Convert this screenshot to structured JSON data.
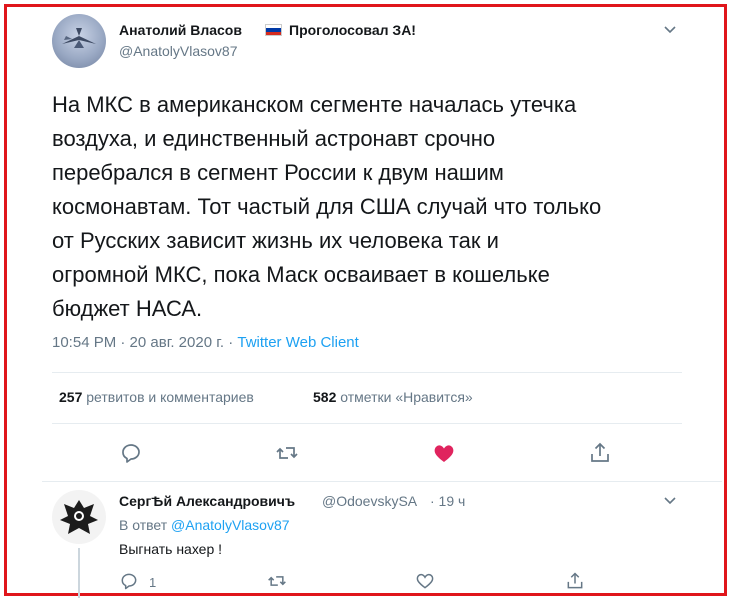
{
  "tweet": {
    "author_name": "Анатолий Власов",
    "voted_text": "Проголосовал ЗА!",
    "handle": "@AnatolyVlasov87",
    "text": "На МКС в американском сегменте началась утечка\nвоздуха, и единственный астронавт срочно\nперебрался в сегмент России к двум нашим\nкосмонавтам. Тот частый для США случай что только\nот Русских зависит жизнь их человека так и\nогромной МКС, пока Маск осваивает в кошельке\nбюджет НАСА.",
    "time": "10:54 PM · 20 авг. 2020 г.",
    "separator": " · ",
    "client": "Twitter Web Client",
    "retweets_count": "257",
    "retweets_label": "ретвитов и комментариев",
    "likes_count": "582",
    "likes_label": "отметки «Нравится»",
    "like_color": "#e0245e",
    "flag_colors": [
      "#ffffff",
      "#0039a6",
      "#d52b1e"
    ]
  },
  "reply": {
    "author_name": "СергѢй Александровичъ",
    "handle": "@OdoevskySA",
    "time": "· 19 ч",
    "in_reply_prefix": "В ответ",
    "in_reply_handle": "@AnatolyVlasov87",
    "text": "Выгнать нахер !",
    "reply_count": "1"
  },
  "icons": [
    "reply-icon",
    "retweet-icon",
    "like-icon",
    "share-icon",
    "chevron-down-icon"
  ],
  "frame_color": "#e0161b"
}
